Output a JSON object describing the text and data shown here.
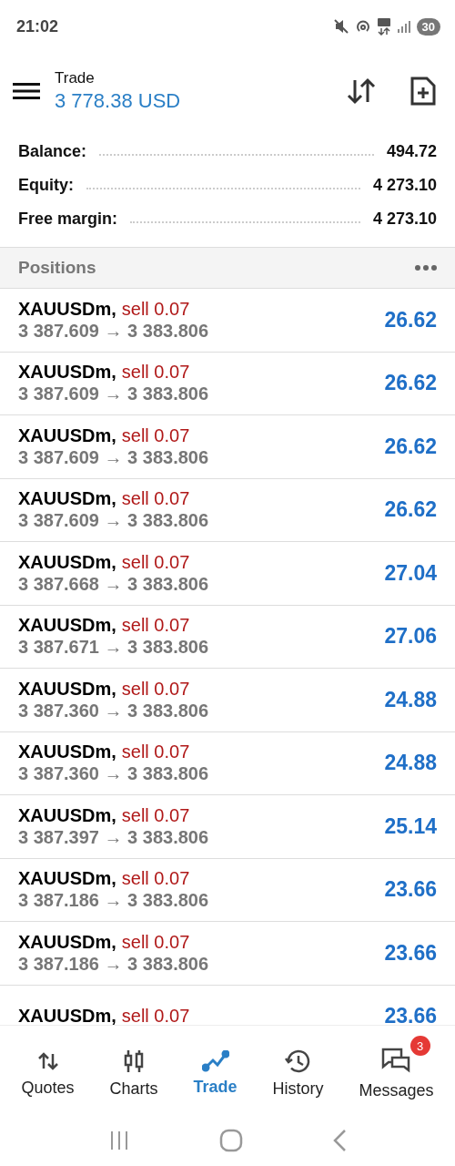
{
  "status_bar": {
    "time": "21:02",
    "battery": "30"
  },
  "header": {
    "title": "Trade",
    "balance": "3 778.38 USD"
  },
  "summary": [
    {
      "label": "Balance:",
      "value": "494.72"
    },
    {
      "label": "Equity:",
      "value": "4 273.10"
    },
    {
      "label": "Free margin:",
      "value": "4 273.10"
    }
  ],
  "positions": {
    "title": "Positions",
    "rows": [
      {
        "symbol": "XAUUSDm,",
        "side": "sell 0.07",
        "prices": "3 387.609 → 3 383.806",
        "profit": "26.62"
      },
      {
        "symbol": "XAUUSDm,",
        "side": "sell 0.07",
        "prices": "3 387.609 → 3 383.806",
        "profit": "26.62"
      },
      {
        "symbol": "XAUUSDm,",
        "side": "sell 0.07",
        "prices": "3 387.609 → 3 383.806",
        "profit": "26.62"
      },
      {
        "symbol": "XAUUSDm,",
        "side": "sell 0.07",
        "prices": "3 387.609 → 3 383.806",
        "profit": "26.62"
      },
      {
        "symbol": "XAUUSDm,",
        "side": "sell 0.07",
        "prices": "3 387.668 → 3 383.806",
        "profit": "27.04"
      },
      {
        "symbol": "XAUUSDm,",
        "side": "sell 0.07",
        "prices": "3 387.671 → 3 383.806",
        "profit": "27.06"
      },
      {
        "symbol": "XAUUSDm,",
        "side": "sell 0.07",
        "prices": "3 387.360 → 3 383.806",
        "profit": "24.88"
      },
      {
        "symbol": "XAUUSDm,",
        "side": "sell 0.07",
        "prices": "3 387.360 → 3 383.806",
        "profit": "24.88"
      },
      {
        "symbol": "XAUUSDm,",
        "side": "sell 0.07",
        "prices": "3 387.397 → 3 383.806",
        "profit": "25.14"
      },
      {
        "symbol": "XAUUSDm,",
        "side": "sell 0.07",
        "prices": "3 387.186 → 3 383.806",
        "profit": "23.66"
      },
      {
        "symbol": "XAUUSDm,",
        "side": "sell 0.07",
        "prices": "3 387.186 → 3 383.806",
        "profit": "23.66"
      },
      {
        "symbol": "XAUUSDm,",
        "side": "sell 0.07",
        "profit": "23.66"
      }
    ]
  },
  "bottom_nav": [
    {
      "kind": "quotes",
      "label": "Quotes",
      "selected": false
    },
    {
      "kind": "charts",
      "label": "Charts",
      "selected": false
    },
    {
      "kind": "trade",
      "label": "Trade",
      "selected": true
    },
    {
      "kind": "history",
      "label": "History",
      "selected": false
    },
    {
      "kind": "messages",
      "label": "Messages",
      "selected": false,
      "badge": "3"
    }
  ]
}
